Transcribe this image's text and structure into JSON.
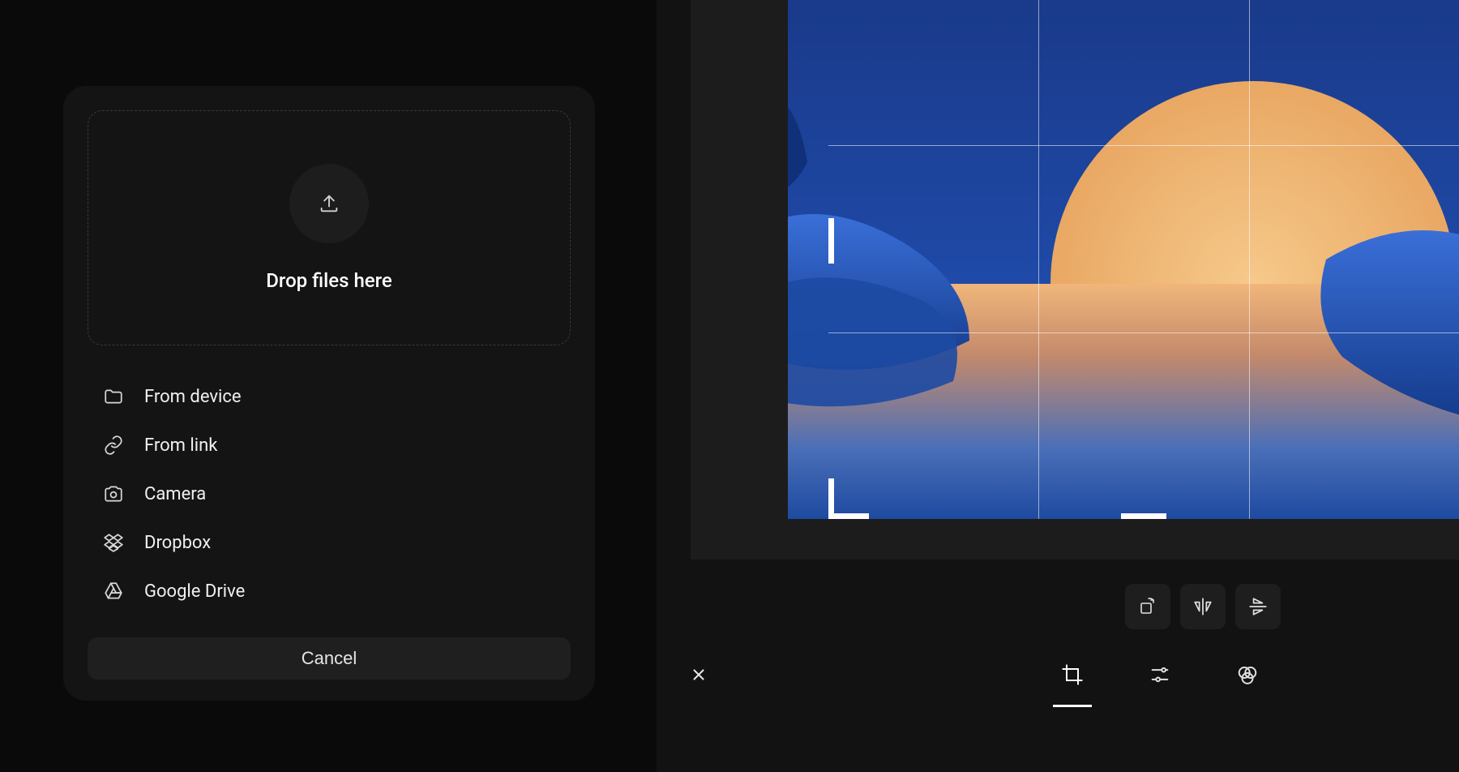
{
  "upload": {
    "dropzone_label": "Drop files here",
    "sources": [
      {
        "icon": "folder-icon",
        "label": "From device"
      },
      {
        "icon": "link-icon",
        "label": "From link"
      },
      {
        "icon": "camera-icon",
        "label": "Camera"
      },
      {
        "icon": "dropbox-icon",
        "label": "Dropbox"
      },
      {
        "icon": "google-drive-icon",
        "label": "Google Drive"
      }
    ],
    "cancel_label": "Cancel"
  },
  "editor": {
    "transform_tools": [
      {
        "icon": "rotate-icon",
        "name": "rotate"
      },
      {
        "icon": "flip-horizontal-icon",
        "name": "flip-horizontal"
      },
      {
        "icon": "flip-vertical-icon",
        "name": "flip-vertical"
      }
    ],
    "tabs": [
      {
        "icon": "crop-icon",
        "name": "crop",
        "active": true
      },
      {
        "icon": "sliders-icon",
        "name": "adjust",
        "active": false
      },
      {
        "icon": "filters-icon",
        "name": "filters",
        "active": false
      }
    ],
    "close_name": "close"
  }
}
